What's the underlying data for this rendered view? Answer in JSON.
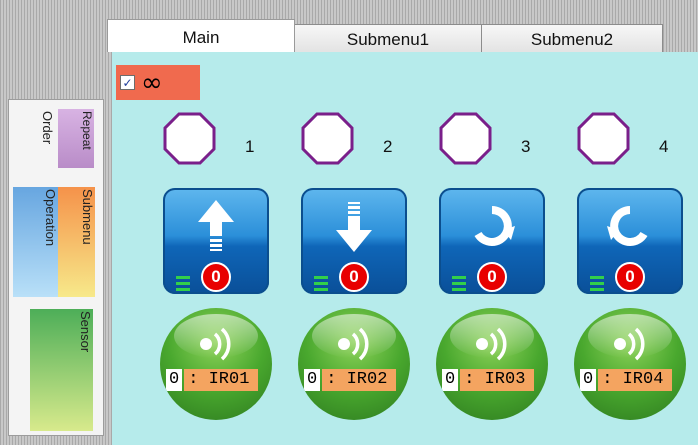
{
  "palette": {
    "repeat": "Repeat",
    "order": "Order",
    "operation": "Operation",
    "submenu": "Submenu",
    "sensor": "Sensor"
  },
  "tabs": [
    {
      "label": "Main",
      "active": true
    },
    {
      "label": "Submenu1",
      "active": false
    },
    {
      "label": "Submenu2",
      "active": false
    }
  ],
  "repeat_toggle": {
    "checked": true,
    "checkmark": "✓",
    "symbol": "∞"
  },
  "columns": [
    {
      "number": "1",
      "operation_icon": "arrow-up-icon",
      "count": "0",
      "sensor_index": "0",
      "sensor_name": ": IR01"
    },
    {
      "number": "2",
      "operation_icon": "arrow-down-icon",
      "count": "0",
      "sensor_index": "0",
      "sensor_name": ": IR02"
    },
    {
      "number": "3",
      "operation_icon": "rotate-clockwise-icon",
      "count": "0",
      "sensor_index": "0",
      "sensor_name": ": IR03"
    },
    {
      "number": "4",
      "operation_icon": "rotate-counterclockwise-icon",
      "count": "0",
      "sensor_index": "0",
      "sensor_name": ": IR04"
    }
  ],
  "colors": {
    "panel": "#b6ebeb",
    "repeat_bar": "#f06a4e",
    "order_octagon_stroke": "#7a1f8a",
    "count_badge": "#e80000",
    "sensor_label": "#f4a460"
  }
}
